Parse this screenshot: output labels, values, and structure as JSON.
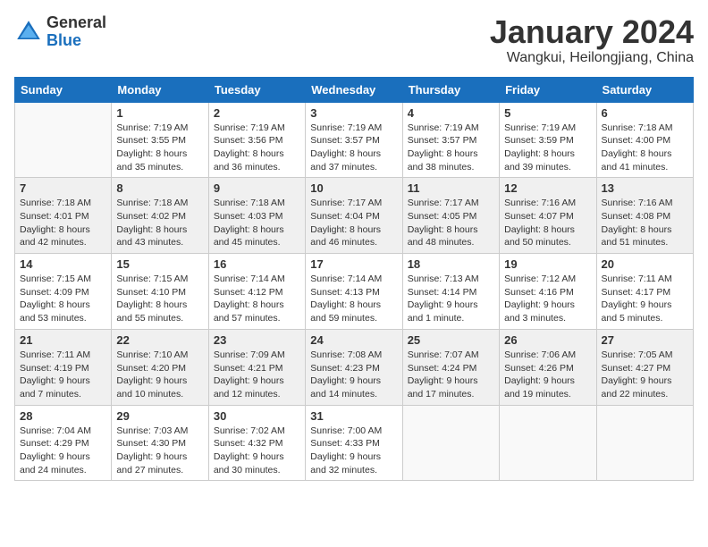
{
  "header": {
    "logo": {
      "general": "General",
      "blue": "Blue"
    },
    "title": "January 2024",
    "subtitle": "Wangkui, Heilongjiang, China"
  },
  "days_of_week": [
    "Sunday",
    "Monday",
    "Tuesday",
    "Wednesday",
    "Thursday",
    "Friday",
    "Saturday"
  ],
  "weeks": [
    [
      {
        "day": "",
        "info": ""
      },
      {
        "day": "1",
        "info": "Sunrise: 7:19 AM\nSunset: 3:55 PM\nDaylight: 8 hours\nand 35 minutes."
      },
      {
        "day": "2",
        "info": "Sunrise: 7:19 AM\nSunset: 3:56 PM\nDaylight: 8 hours\nand 36 minutes."
      },
      {
        "day": "3",
        "info": "Sunrise: 7:19 AM\nSunset: 3:57 PM\nDaylight: 8 hours\nand 37 minutes."
      },
      {
        "day": "4",
        "info": "Sunrise: 7:19 AM\nSunset: 3:57 PM\nDaylight: 8 hours\nand 38 minutes."
      },
      {
        "day": "5",
        "info": "Sunrise: 7:19 AM\nSunset: 3:59 PM\nDaylight: 8 hours\nand 39 minutes."
      },
      {
        "day": "6",
        "info": "Sunrise: 7:18 AM\nSunset: 4:00 PM\nDaylight: 8 hours\nand 41 minutes."
      }
    ],
    [
      {
        "day": "7",
        "info": "Sunrise: 7:18 AM\nSunset: 4:01 PM\nDaylight: 8 hours\nand 42 minutes."
      },
      {
        "day": "8",
        "info": "Sunrise: 7:18 AM\nSunset: 4:02 PM\nDaylight: 8 hours\nand 43 minutes."
      },
      {
        "day": "9",
        "info": "Sunrise: 7:18 AM\nSunset: 4:03 PM\nDaylight: 8 hours\nand 45 minutes."
      },
      {
        "day": "10",
        "info": "Sunrise: 7:17 AM\nSunset: 4:04 PM\nDaylight: 8 hours\nand 46 minutes."
      },
      {
        "day": "11",
        "info": "Sunrise: 7:17 AM\nSunset: 4:05 PM\nDaylight: 8 hours\nand 48 minutes."
      },
      {
        "day": "12",
        "info": "Sunrise: 7:16 AM\nSunset: 4:07 PM\nDaylight: 8 hours\nand 50 minutes."
      },
      {
        "day": "13",
        "info": "Sunrise: 7:16 AM\nSunset: 4:08 PM\nDaylight: 8 hours\nand 51 minutes."
      }
    ],
    [
      {
        "day": "14",
        "info": "Sunrise: 7:15 AM\nSunset: 4:09 PM\nDaylight: 8 hours\nand 53 minutes."
      },
      {
        "day": "15",
        "info": "Sunrise: 7:15 AM\nSunset: 4:10 PM\nDaylight: 8 hours\nand 55 minutes."
      },
      {
        "day": "16",
        "info": "Sunrise: 7:14 AM\nSunset: 4:12 PM\nDaylight: 8 hours\nand 57 minutes."
      },
      {
        "day": "17",
        "info": "Sunrise: 7:14 AM\nSunset: 4:13 PM\nDaylight: 8 hours\nand 59 minutes."
      },
      {
        "day": "18",
        "info": "Sunrise: 7:13 AM\nSunset: 4:14 PM\nDaylight: 9 hours\nand 1 minute."
      },
      {
        "day": "19",
        "info": "Sunrise: 7:12 AM\nSunset: 4:16 PM\nDaylight: 9 hours\nand 3 minutes."
      },
      {
        "day": "20",
        "info": "Sunrise: 7:11 AM\nSunset: 4:17 PM\nDaylight: 9 hours\nand 5 minutes."
      }
    ],
    [
      {
        "day": "21",
        "info": "Sunrise: 7:11 AM\nSunset: 4:19 PM\nDaylight: 9 hours\nand 7 minutes."
      },
      {
        "day": "22",
        "info": "Sunrise: 7:10 AM\nSunset: 4:20 PM\nDaylight: 9 hours\nand 10 minutes."
      },
      {
        "day": "23",
        "info": "Sunrise: 7:09 AM\nSunset: 4:21 PM\nDaylight: 9 hours\nand 12 minutes."
      },
      {
        "day": "24",
        "info": "Sunrise: 7:08 AM\nSunset: 4:23 PM\nDaylight: 9 hours\nand 14 minutes."
      },
      {
        "day": "25",
        "info": "Sunrise: 7:07 AM\nSunset: 4:24 PM\nDaylight: 9 hours\nand 17 minutes."
      },
      {
        "day": "26",
        "info": "Sunrise: 7:06 AM\nSunset: 4:26 PM\nDaylight: 9 hours\nand 19 minutes."
      },
      {
        "day": "27",
        "info": "Sunrise: 7:05 AM\nSunset: 4:27 PM\nDaylight: 9 hours\nand 22 minutes."
      }
    ],
    [
      {
        "day": "28",
        "info": "Sunrise: 7:04 AM\nSunset: 4:29 PM\nDaylight: 9 hours\nand 24 minutes."
      },
      {
        "day": "29",
        "info": "Sunrise: 7:03 AM\nSunset: 4:30 PM\nDaylight: 9 hours\nand 27 minutes."
      },
      {
        "day": "30",
        "info": "Sunrise: 7:02 AM\nSunset: 4:32 PM\nDaylight: 9 hours\nand 30 minutes."
      },
      {
        "day": "31",
        "info": "Sunrise: 7:00 AM\nSunset: 4:33 PM\nDaylight: 9 hours\nand 32 minutes."
      },
      {
        "day": "",
        "info": ""
      },
      {
        "day": "",
        "info": ""
      },
      {
        "day": "",
        "info": ""
      }
    ]
  ]
}
